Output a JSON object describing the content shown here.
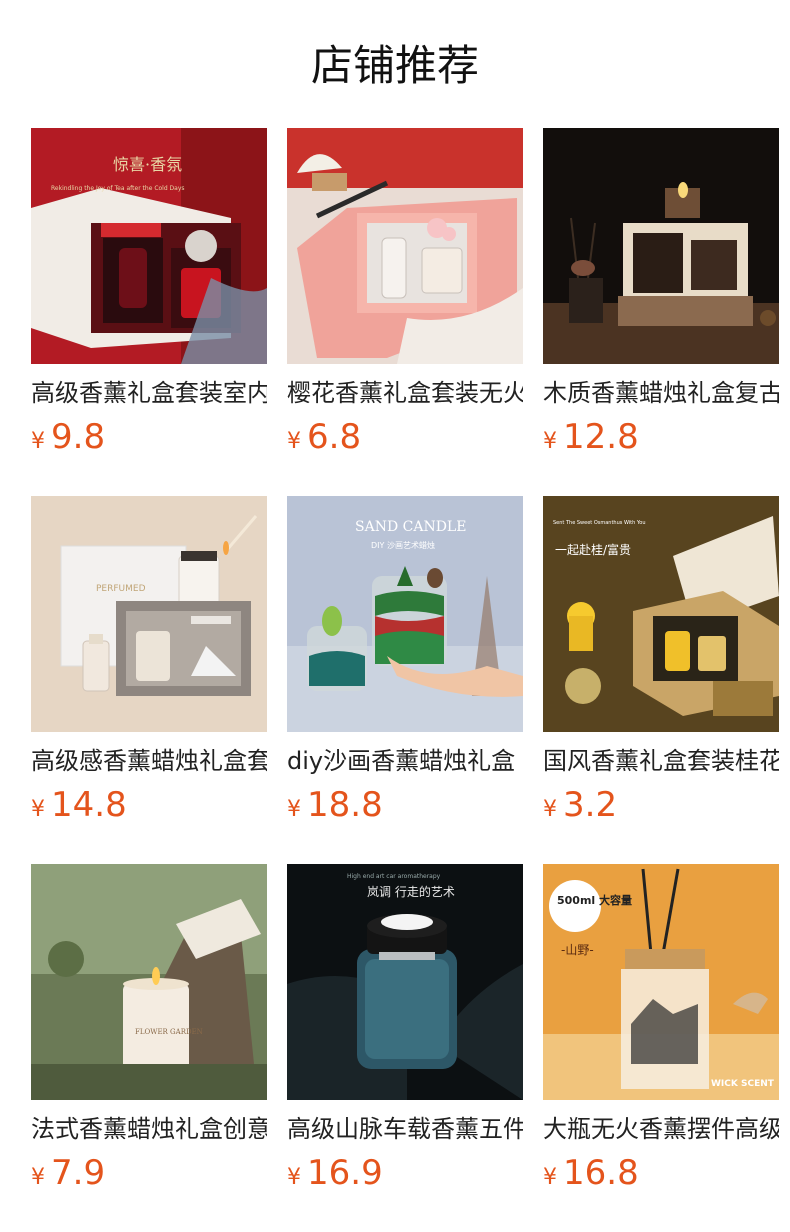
{
  "section_title": "店铺推荐",
  "currency_symbol": "¥",
  "products": [
    {
      "name": "高级香薰礼盒套装室内",
      "price": "9.8",
      "image_text": "惊喜·香氛",
      "image_subtext": "Rekindling the Joy of Tea after the Cold Days"
    },
    {
      "name": "樱花香薰礼盒套装无火",
      "price": "6.8",
      "image_text": "",
      "image_subtext": ""
    },
    {
      "name": "木质香薰蜡烛礼盒复古",
      "price": "12.8",
      "image_text": "",
      "image_subtext": ""
    },
    {
      "name": "高级感香薰蜡烛礼盒套",
      "price": "14.8",
      "image_text": "PERFUMED",
      "image_subtext": ""
    },
    {
      "name": "diy沙画香薰蜡烛礼盒",
      "price": "18.8",
      "image_text": "SAND CANDLE",
      "image_subtext": "DIY 沙画艺术蜡烛"
    },
    {
      "name": "国风香薰礼盒套装桂花",
      "price": "3.2",
      "image_text": "一起赴桂/富贵",
      "image_subtext": "Sent The Sweet Osmanthus With You"
    },
    {
      "name": "法式香薰蜡烛礼盒创意",
      "price": "7.9",
      "image_text": "FLOWER GARDEN",
      "image_subtext": ""
    },
    {
      "name": "高级山脉车载香薰五件",
      "price": "16.9",
      "image_text": "岚调 行走的艺术",
      "image_subtext": "High end art car aromatherapy"
    },
    {
      "name": "大瓶无火香薰摆件高级",
      "price": "16.8",
      "image_text": "500ml 大容量",
      "image_subtext": "-山野-",
      "image_brand": "WICK SCENT"
    }
  ]
}
